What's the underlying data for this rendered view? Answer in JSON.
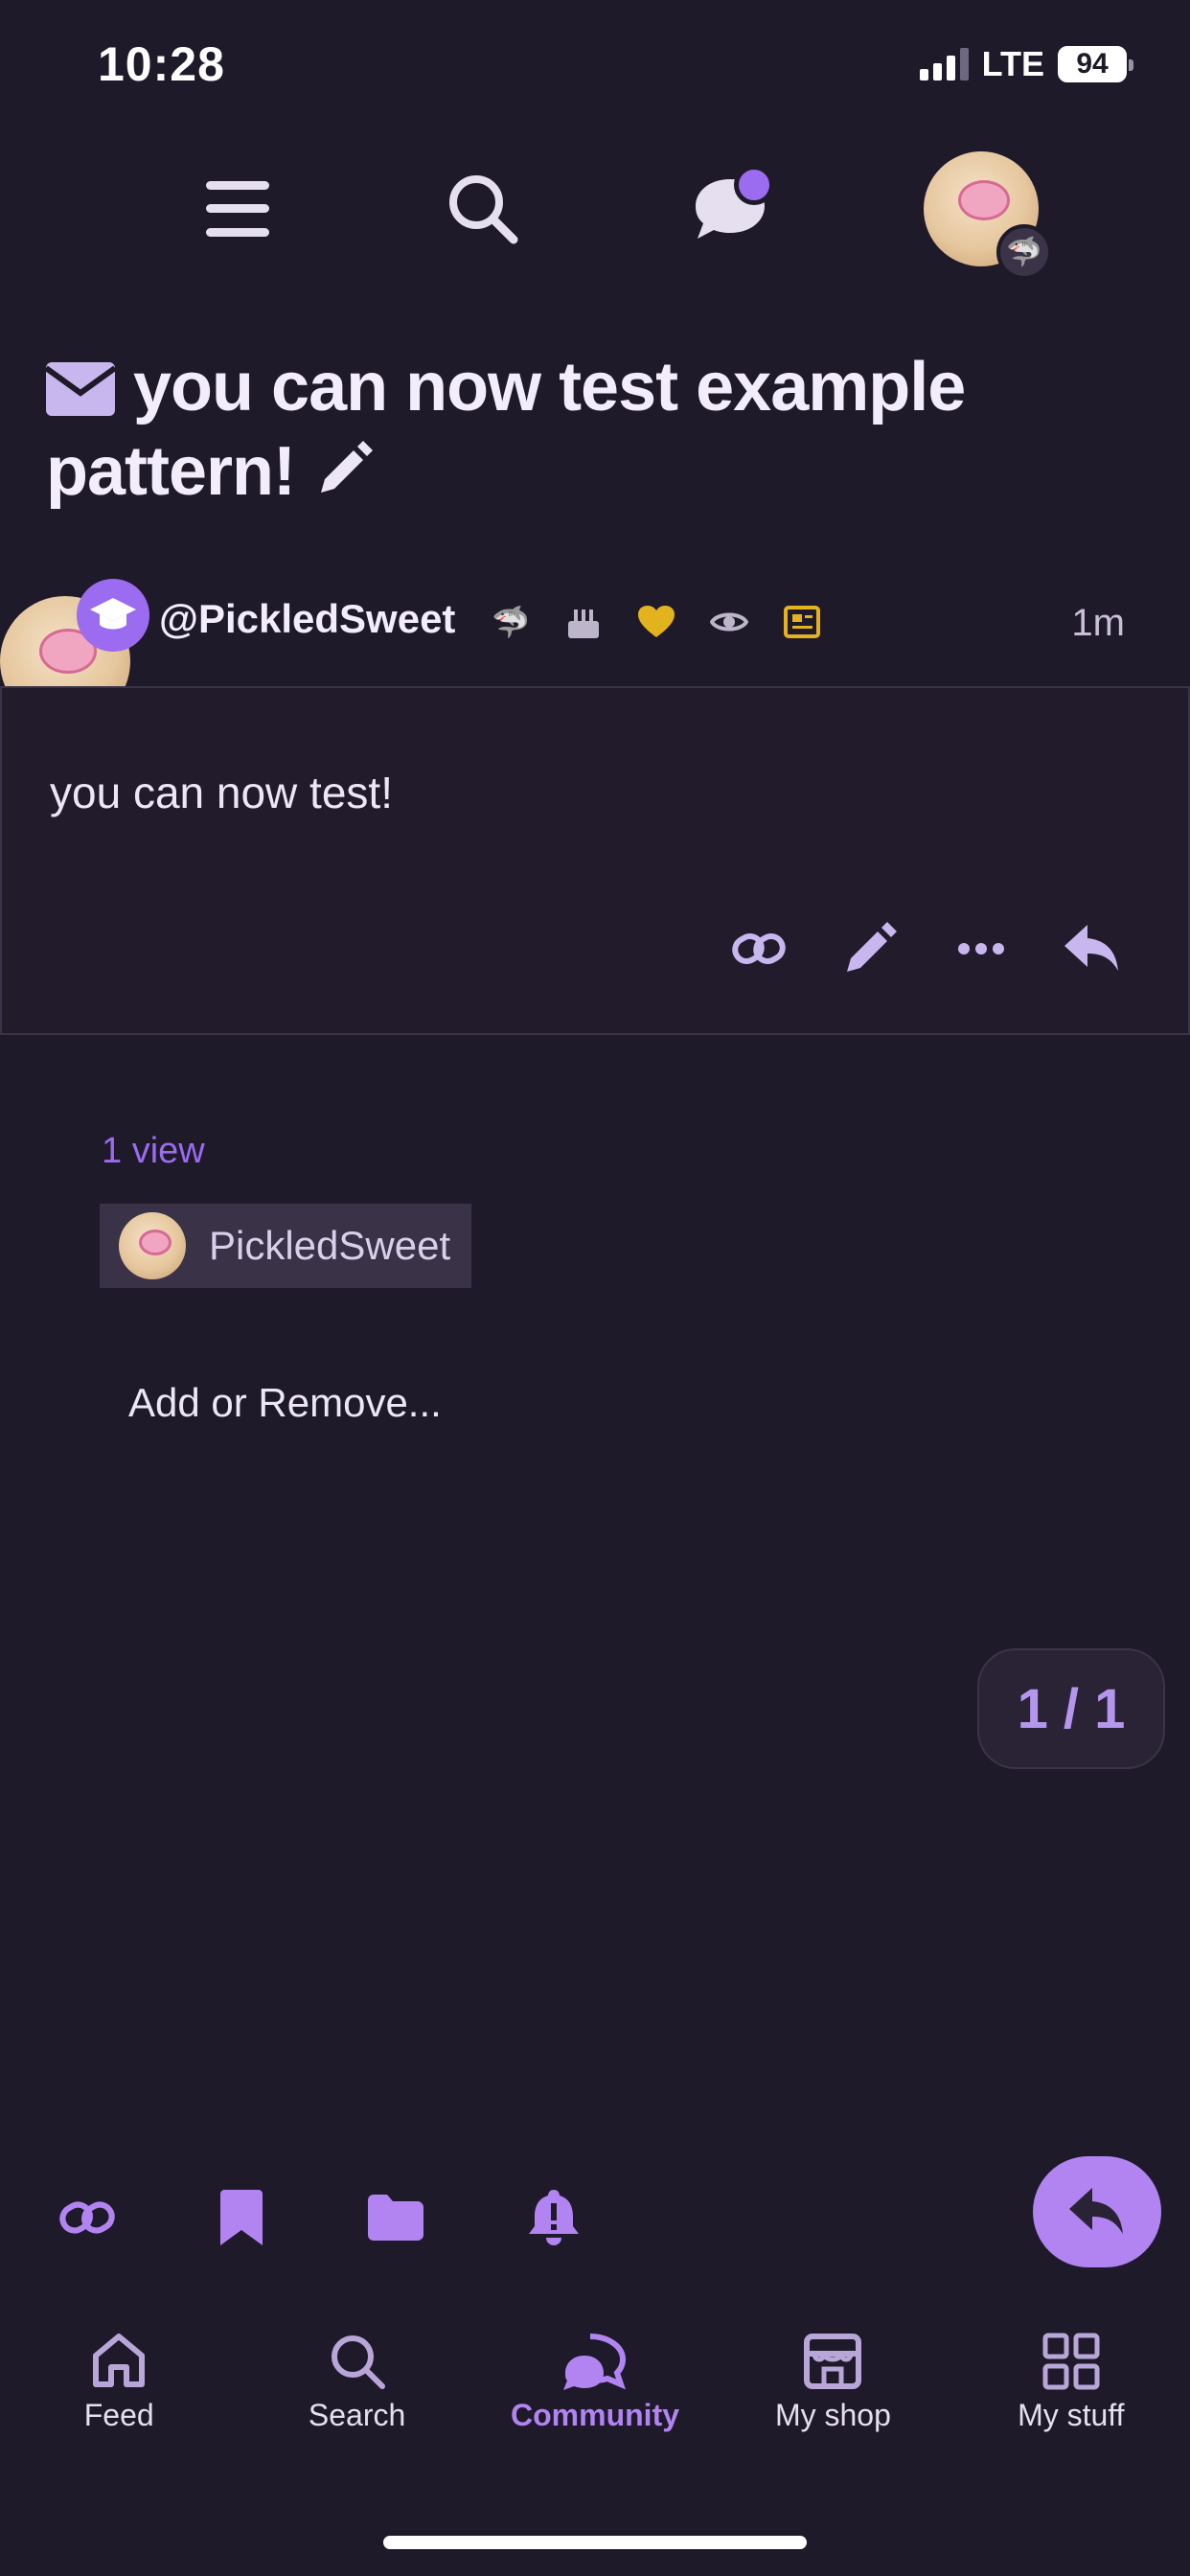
{
  "status_bar": {
    "time": "10:28",
    "network": "LTE",
    "battery": "94"
  },
  "topic": {
    "title": "you can now test example pattern!"
  },
  "post": {
    "username": "@PickledSweet",
    "time_ago": "1m",
    "body": "you can now test!",
    "badges": [
      "shark-icon",
      "cake-icon",
      "heart-icon",
      "eye-icon",
      "newspaper-icon"
    ]
  },
  "viewers": {
    "count_label": "1 view",
    "items": [
      "PickledSweet"
    ],
    "add_remove_label": "Add or Remove..."
  },
  "pagination": {
    "label": "1 / 1"
  },
  "bottom_nav": {
    "items": [
      {
        "label": "Feed",
        "icon": "home-icon"
      },
      {
        "label": "Search",
        "icon": "search-icon"
      },
      {
        "label": "Community",
        "icon": "community-icon"
      },
      {
        "label": "My shop",
        "icon": "shop-icon"
      },
      {
        "label": "My stuff",
        "icon": "grid-icon"
      }
    ],
    "active": "Community"
  },
  "colors": {
    "background": "#1f1a29",
    "accent": "#9b6bf0",
    "accent_light": "#b184f2",
    "gold": "#e3b21f"
  }
}
